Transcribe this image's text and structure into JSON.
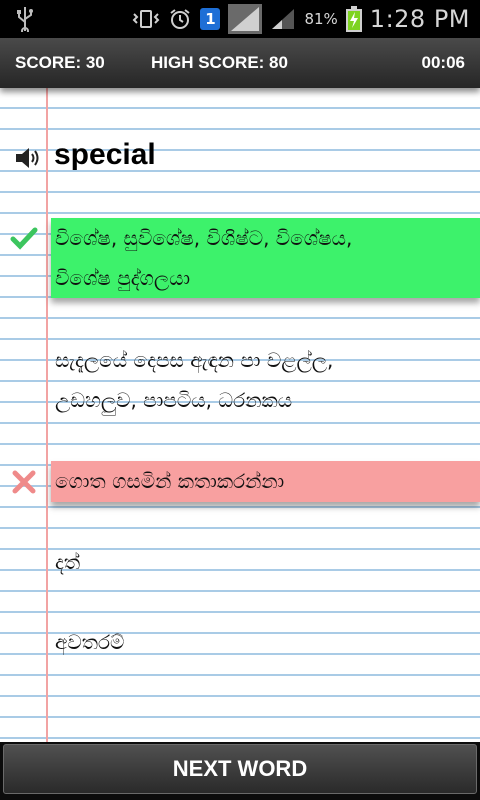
{
  "status_bar": {
    "battery_percent": "81%",
    "time": "1:28 PM",
    "notification_badge": "1",
    "icons": [
      "usb-icon",
      "vibrate-icon",
      "alarm-icon",
      "notification-badge-icon",
      "signal-icon",
      "signal-weak-icon",
      "battery-charging-icon"
    ]
  },
  "score_bar": {
    "score": "SCORE: 30",
    "high_score": "HIGH SCORE: 80",
    "timer": "00:06"
  },
  "quiz": {
    "word": "special",
    "options": [
      {
        "line1": "විශේෂ, සුවිශේෂ, විශිෂ්ට, විශේෂය,",
        "line2": "විශේෂ පුද්ගලයා",
        "state": "correct"
      },
      {
        "line1": "සැදැලයේ දෙපස   ඇඳන පා වළල්ල,",
        "line2": "උඩහලුව, පාපටිය, ධරනකය",
        "state": "none"
      },
      {
        "line1": "ගොත ගසමින් කතාකරන්නා",
        "line2": "",
        "state": "wrong"
      },
      {
        "line1": "දත්",
        "line2": "",
        "state": "none"
      },
      {
        "line1": "අවතරම්",
        "line2": "",
        "state": "none"
      }
    ]
  },
  "colors": {
    "correct_bg": "#3df26b",
    "wrong_bg": "#f8a0a0",
    "check_mark": "#3cc55e",
    "cross_mark": "#ef8a8a",
    "rule_line": "#a9cbe6",
    "margin_line": "#f2a3a3"
  },
  "bottom": {
    "next_label": "NEXT WORD"
  }
}
